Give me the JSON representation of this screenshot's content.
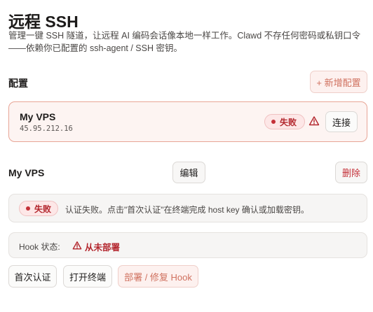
{
  "page": {
    "title": "远程 SSH",
    "description": "管理一键 SSH 隧道，让远程 AI 编码会话像本地一样工作。Clawd 不存任何密码或私钥口令——依赖你已配置的 ssh-agent / SSH 密钥。"
  },
  "config": {
    "section_label": "配置",
    "add_button": "+ 新增配置",
    "cards": [
      {
        "name": "My VPS",
        "host": "45.95.212.16",
        "status": "失败",
        "connect_label": "连接"
      }
    ]
  },
  "detail": {
    "name": "My VPS",
    "edit_label": "编辑",
    "delete_label": "删除",
    "error_status": "失败",
    "error_message": "认证失败。点击\"首次认证\"在终端完成 host key 确认或加载密钥。",
    "hook_label": "Hook 状态:",
    "hook_status": "从未部署",
    "actions": {
      "first_auth": "首次认证",
      "open_terminal": "打开终端",
      "deploy_hook": "部署 / 修复 Hook"
    }
  },
  "colors": {
    "accent": "#d0715f",
    "danger": "#b3262d",
    "card_border": "#e8a596"
  }
}
